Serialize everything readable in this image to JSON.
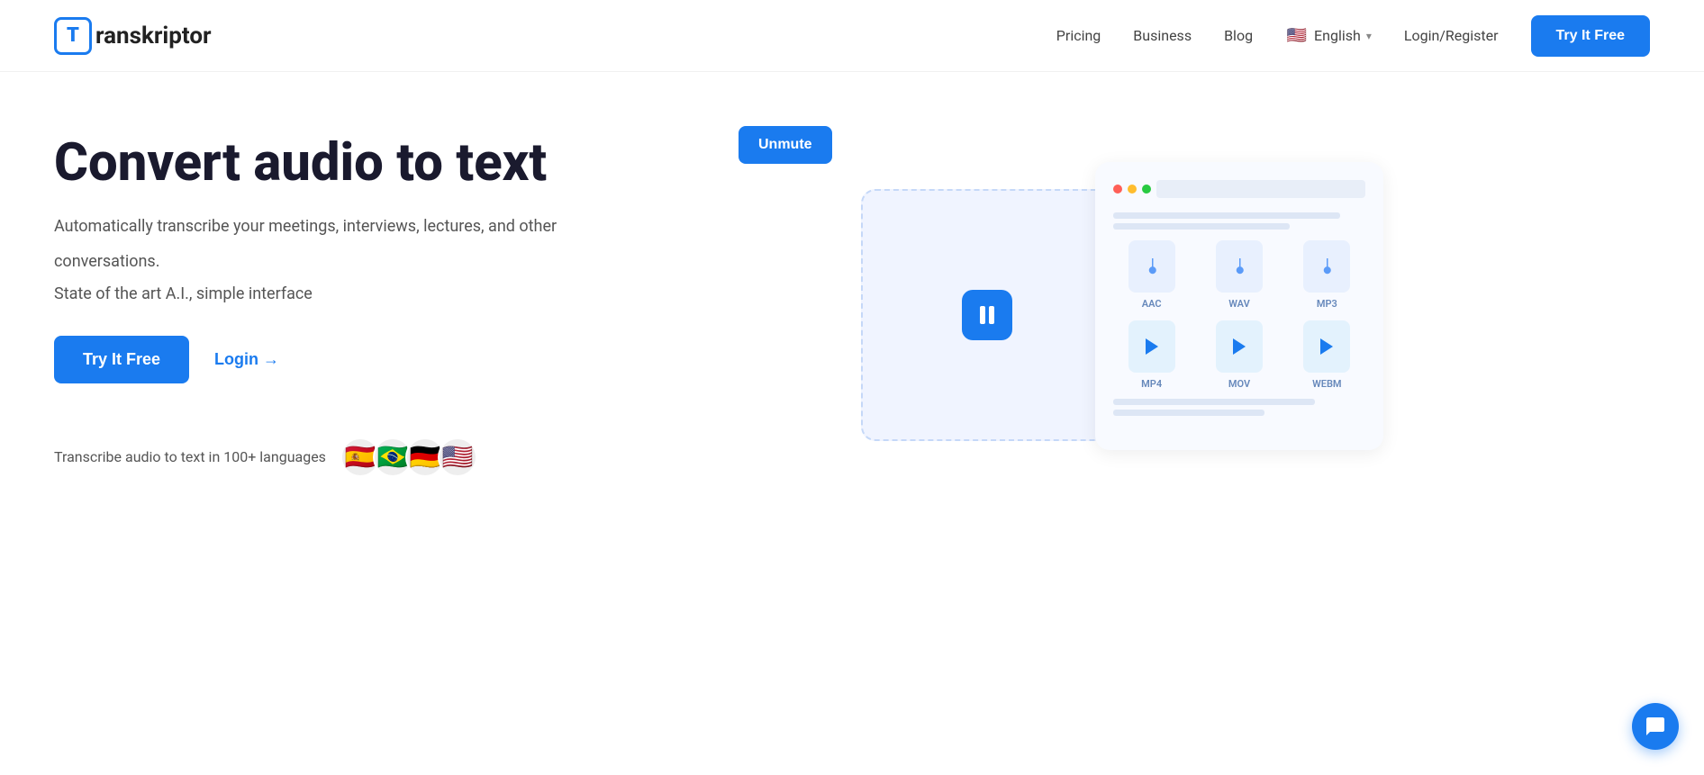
{
  "header": {
    "logo_letter": "T",
    "logo_name": "ranskriptor",
    "nav": [
      {
        "label": "Pricing",
        "id": "pricing"
      },
      {
        "label": "Business",
        "id": "business"
      },
      {
        "label": "Blog",
        "id": "blog"
      }
    ],
    "language": {
      "flag": "🇺🇸",
      "label": "English"
    },
    "login_label": "Login/Register",
    "cta_label": "Try It Free"
  },
  "hero": {
    "title": "Convert audio to text",
    "subtitle1": "Automatically transcribe your meetings, interviews, lectures, and other",
    "subtitle2": "conversations.",
    "subtitle3": "State of the art A.I., simple interface",
    "cta_primary": "Try It Free",
    "cta_login": "Login →",
    "languages_text": "Transcribe audio to text in 100+ languages",
    "flags": [
      "🇪🇸",
      "🇧🇷",
      "🇩🇪",
      "🇺🇸"
    ],
    "unmute_label": "Unmute",
    "formats": [
      {
        "label": "AAC",
        "type": "audio"
      },
      {
        "label": "WAV",
        "type": "audio"
      },
      {
        "label": "MP3",
        "type": "audio"
      },
      {
        "label": "MP4",
        "type": "video"
      },
      {
        "label": "MOV",
        "type": "video"
      },
      {
        "label": "WEBM",
        "type": "video"
      }
    ]
  },
  "chat": {
    "icon": "chat-icon"
  }
}
